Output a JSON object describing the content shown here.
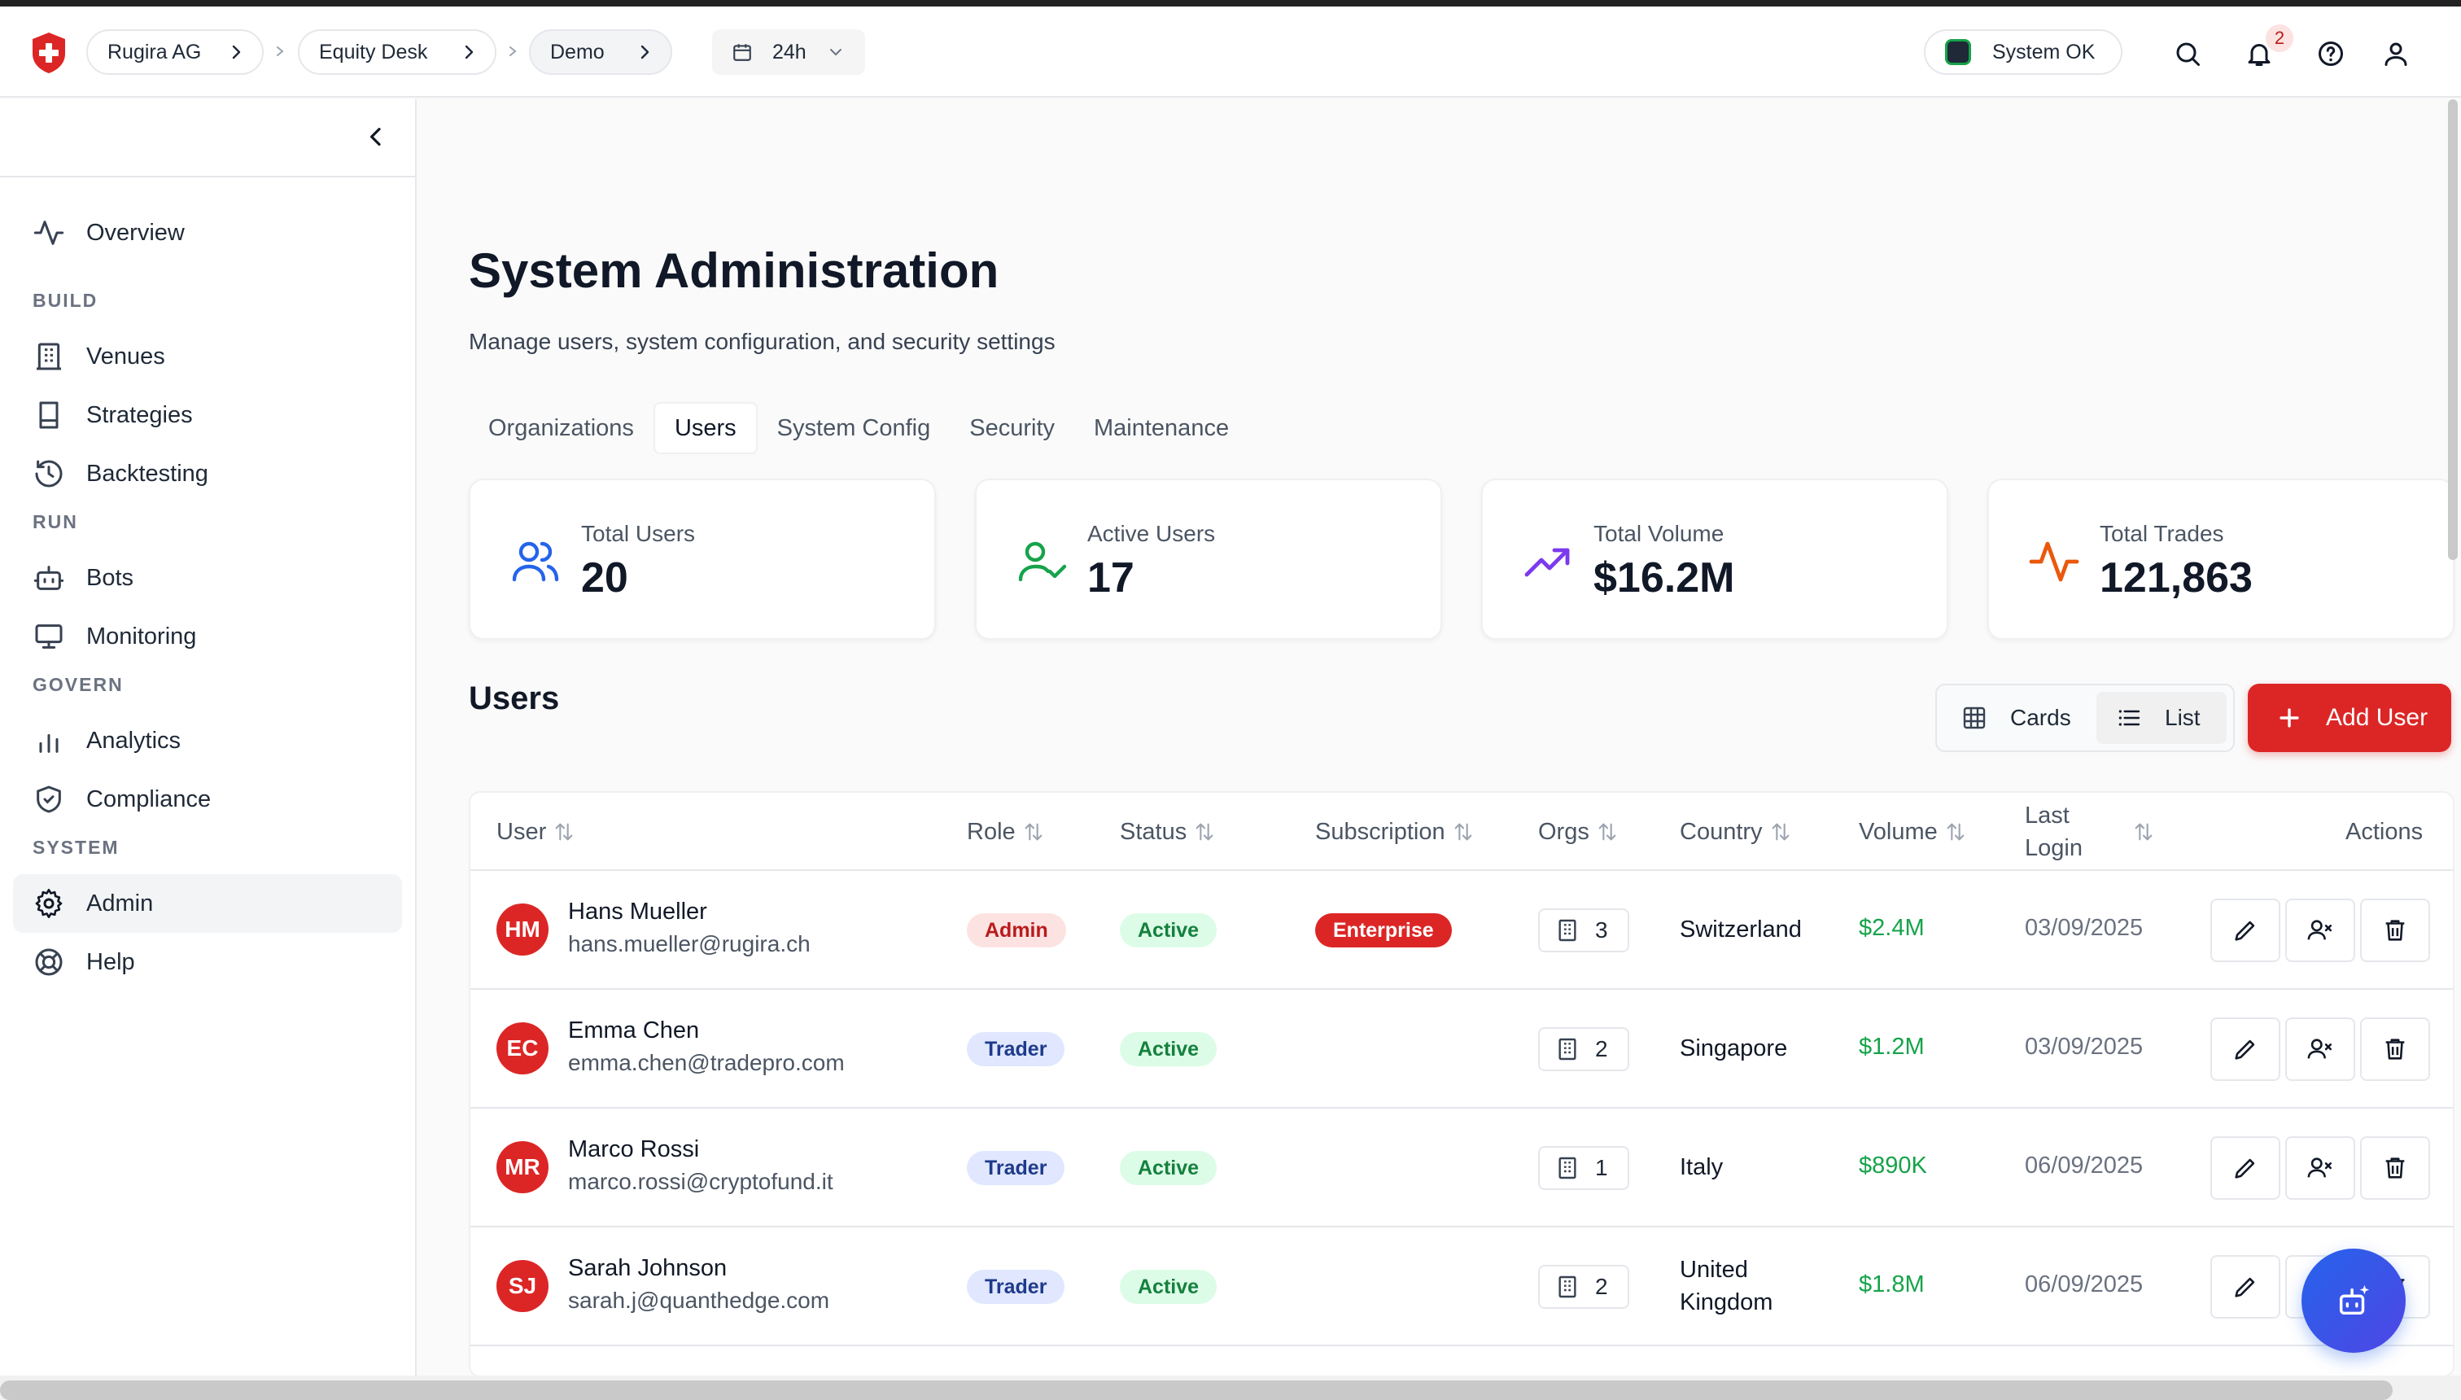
{
  "breadcrumb": [
    {
      "label": "Rugira AG"
    },
    {
      "label": "Equity Desk"
    },
    {
      "label": "Demo"
    }
  ],
  "time_range": {
    "label": "24h"
  },
  "system_status": {
    "label": "System OK",
    "color": "#16a34a"
  },
  "notifications": {
    "count": "2"
  },
  "sidebar": {
    "overview": "Overview",
    "sections": {
      "build": "BUILD",
      "run": "RUN",
      "govern": "GOVERN",
      "system": "SYSTEM"
    },
    "items": {
      "venues": "Venues",
      "strategies": "Strategies",
      "backtesting": "Backtesting",
      "bots": "Bots",
      "monitoring": "Monitoring",
      "analytics": "Analytics",
      "compliance": "Compliance",
      "admin": "Admin",
      "help": "Help"
    },
    "active": "Admin"
  },
  "page": {
    "title": "System Administration",
    "subtitle": "Manage users, system configuration, and security settings"
  },
  "tabs": [
    {
      "label": "Organizations"
    },
    {
      "label": "Users",
      "active": true
    },
    {
      "label": "System Config"
    },
    {
      "label": "Security"
    },
    {
      "label": "Maintenance"
    }
  ],
  "stats": {
    "total_users": {
      "label": "Total Users",
      "value": "20",
      "icon": "users-icon"
    },
    "active_users": {
      "label": "Active Users",
      "value": "17",
      "icon": "user-check-icon"
    },
    "total_volume": {
      "label": "Total Volume",
      "value": "$16.2M",
      "icon": "trending-up-icon"
    },
    "total_trades": {
      "label": "Total Trades",
      "value": "121,863",
      "icon": "activity-icon"
    }
  },
  "users_section": {
    "title": "Users",
    "view_cards": "Cards",
    "view_list": "List",
    "add_user": "Add User"
  },
  "table": {
    "headers": {
      "user": "User",
      "role": "Role",
      "status": "Status",
      "subscription": "Subscription",
      "orgs": "Orgs",
      "country": "Country",
      "volume": "Volume",
      "last_login_1": "Last",
      "last_login_2": "Login",
      "actions": "Actions"
    },
    "rows": [
      {
        "initials": "HM",
        "name": "Hans Mueller",
        "email": "hans.mueller@rugira.ch",
        "role": "Admin",
        "status": "Active",
        "subscription": "Enterprise",
        "orgs": "3",
        "country": "Switzerland",
        "volume": "$2.4M",
        "last_login": "03/09/2025"
      },
      {
        "initials": "EC",
        "name": "Emma Chen",
        "email": "emma.chen@tradepro.com",
        "role": "Trader",
        "status": "Active",
        "subscription": "",
        "orgs": "2",
        "country": "Singapore",
        "volume": "$1.2M",
        "last_login": "03/09/2025"
      },
      {
        "initials": "MR",
        "name": "Marco Rossi",
        "email": "marco.rossi@cryptofund.it",
        "role": "Trader",
        "status": "Active",
        "subscription": "",
        "orgs": "1",
        "country": "Italy",
        "volume": "$890K",
        "last_login": "06/09/2025"
      },
      {
        "initials": "SJ",
        "name": "Sarah Johnson",
        "email": "sarah.j@quanthedge.com",
        "role": "Trader",
        "status": "Active",
        "subscription": "",
        "orgs": "2",
        "country_line1": "United",
        "country_line2": "Kingdom",
        "volume": "$1.8M",
        "last_login": "06/09/2025"
      }
    ]
  },
  "colors": {
    "brand_red": "#dc2626",
    "positive_green": "#16a34a",
    "fab_blue": "#2563eb"
  }
}
